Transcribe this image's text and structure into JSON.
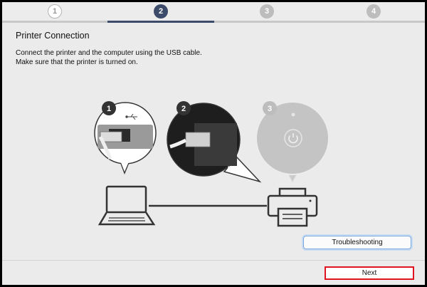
{
  "steps": [
    {
      "label": "1",
      "state": "done"
    },
    {
      "label": "2",
      "state": "active"
    },
    {
      "label": "3",
      "state": "todo"
    },
    {
      "label": "4",
      "state": "todo"
    }
  ],
  "header": {
    "title": "Printer Connection"
  },
  "instructions": {
    "line1": "Connect the printer and the computer using the USB cable.",
    "line2": "Make sure that the printer is turned on."
  },
  "illustration": {
    "callouts": [
      "1",
      "2",
      "3"
    ],
    "icons": [
      "laptop-icon",
      "printer-icon",
      "usb-symbol-icon",
      "power-button-icon"
    ]
  },
  "buttons": {
    "troubleshooting": "Troubleshooting",
    "next": "Next"
  },
  "colors": {
    "active_step": "#3d4b6a",
    "highlight": "#e0141e",
    "background": "#ebebeb"
  }
}
